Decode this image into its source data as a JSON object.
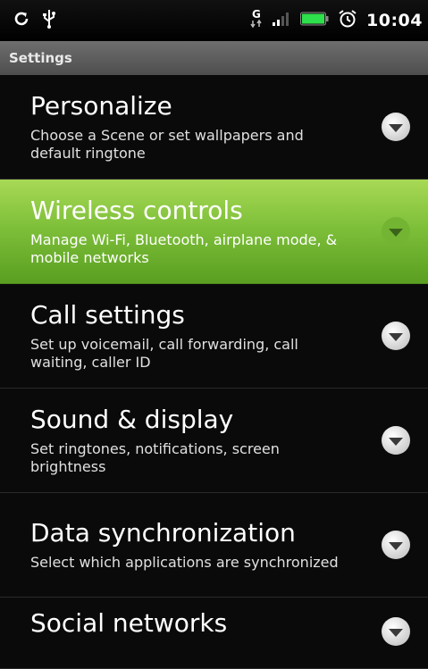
{
  "status_bar": {
    "time": "10:04",
    "icons": [
      "sync-icon",
      "usb-icon",
      "data-transfer-icon",
      "signal-icon",
      "battery-icon",
      "alarm-icon"
    ]
  },
  "title_bar": {
    "title": "Settings"
  },
  "settings": [
    {
      "title": "Personalize",
      "summary": "Choose a Scene or set wallpapers and default ringtone"
    },
    {
      "title": "Wireless controls",
      "summary": "Manage Wi-Fi, Bluetooth, airplane mode, & mobile networks"
    },
    {
      "title": "Call settings",
      "summary": "Set up voicemail, call forwarding, call waiting, caller ID"
    },
    {
      "title": "Sound & display",
      "summary": "Set ringtones, notifications, screen brightness"
    },
    {
      "title": "Data synchronization",
      "summary": "Select which applications are synchronized"
    },
    {
      "title": "Social networks",
      "summary": ""
    }
  ],
  "colors": {
    "background": "#0a0a0a",
    "highlight": "#7fc03a",
    "title_bar": "#5a5a5a"
  }
}
